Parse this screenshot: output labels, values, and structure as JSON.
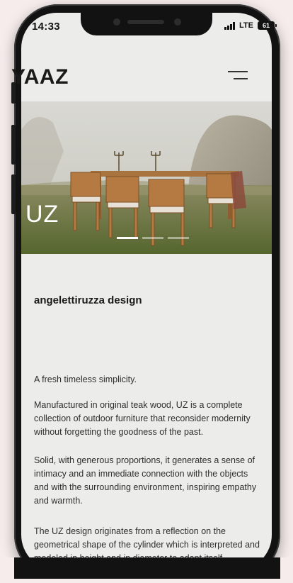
{
  "status": {
    "time": "14:33",
    "network": "LTE",
    "battery": "61"
  },
  "header": {
    "brand": "YAAZ"
  },
  "hero": {
    "title": "UZ",
    "slides": 3,
    "active_slide": 0
  },
  "content": {
    "subtitle": "angelettiruzza design",
    "paragraphs": [
      "A fresh timeless simplicity.",
      "Manufactured in original teak wood, UZ is a complete collection of outdoor furniture that reconsider modernity without forgetting the goodness of the past.",
      "Solid, with generous proportions, it generates a sense of intimacy and an immediate connection with the objects and with the surrounding environment, inspiring empathy and warmth.",
      "The UZ design originates from a reflection on the geometrical shape of the cylinder which is interpreted and modeled in height and in diameter to adapt itself"
    ]
  },
  "colors": {
    "page_bg": "#f6ecec",
    "screen_bg": "#ececea",
    "frame": "#121212",
    "text": "#2e2e2e"
  }
}
